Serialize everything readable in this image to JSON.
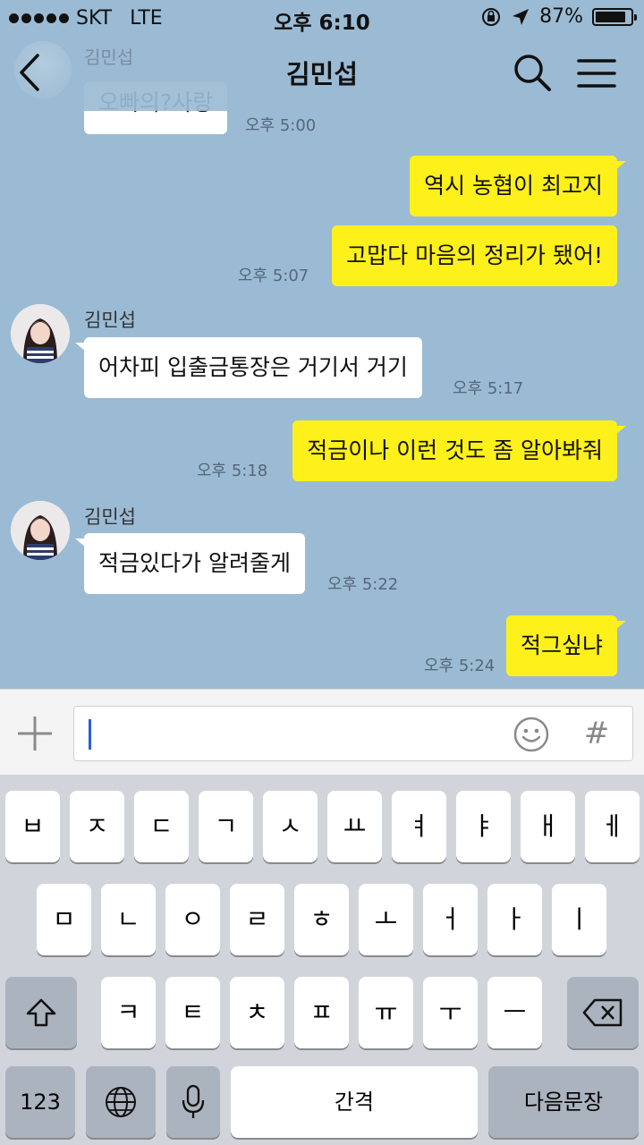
{
  "status_bar": {
    "carrier": "SKT",
    "network": "LTE",
    "time": "오후 6:10",
    "battery": "87%",
    "battery_level": 0.87
  },
  "header": {
    "title": "김민섭",
    "faded_name": "김민섭",
    "faded_message": "오빠의?사랑"
  },
  "messages": [
    {
      "direction": "in",
      "text": "오빠의?사랑",
      "time": "오후 5:00"
    },
    {
      "direction": "out",
      "text": "역시 농협이 최고지",
      "time": ""
    },
    {
      "direction": "out",
      "text": "고맙다 마음의 정리가 됐어!",
      "time": "오후 5:07"
    },
    {
      "direction": "in",
      "sender": "김민섭",
      "text": "어차피 입출금통장은 거기서 거기",
      "time": "오후 5:17"
    },
    {
      "direction": "out",
      "text": "적금이나 이런 것도 좀 알아봐줘",
      "time": "오후 5:18"
    },
    {
      "direction": "in",
      "sender": "김민섭",
      "text": "적금있다가 알려줄게",
      "time": "오후 5:22"
    },
    {
      "direction": "out",
      "text": "적그싶냐",
      "time": "오후 5:24"
    }
  ],
  "input": {
    "value": "",
    "hash_label": "#"
  },
  "keyboard": {
    "row1": [
      "ㅂ",
      "ㅈ",
      "ㄷ",
      "ㄱ",
      "ㅅ",
      "ㅛ",
      "ㅕ",
      "ㅑ",
      "ㅐ",
      "ㅔ"
    ],
    "row2": [
      "ㅁ",
      "ㄴ",
      "ㅇ",
      "ㄹ",
      "ㅎ",
      "ㅗ",
      "ㅓ",
      "ㅏ",
      "ㅣ"
    ],
    "row3": [
      "ㅋ",
      "ㅌ",
      "ㅊ",
      "ㅍ",
      "ㅠ",
      "ㅜ",
      "ㅡ"
    ],
    "numbers_key": "123",
    "space_key": "간격",
    "return_key": "다음문장"
  }
}
